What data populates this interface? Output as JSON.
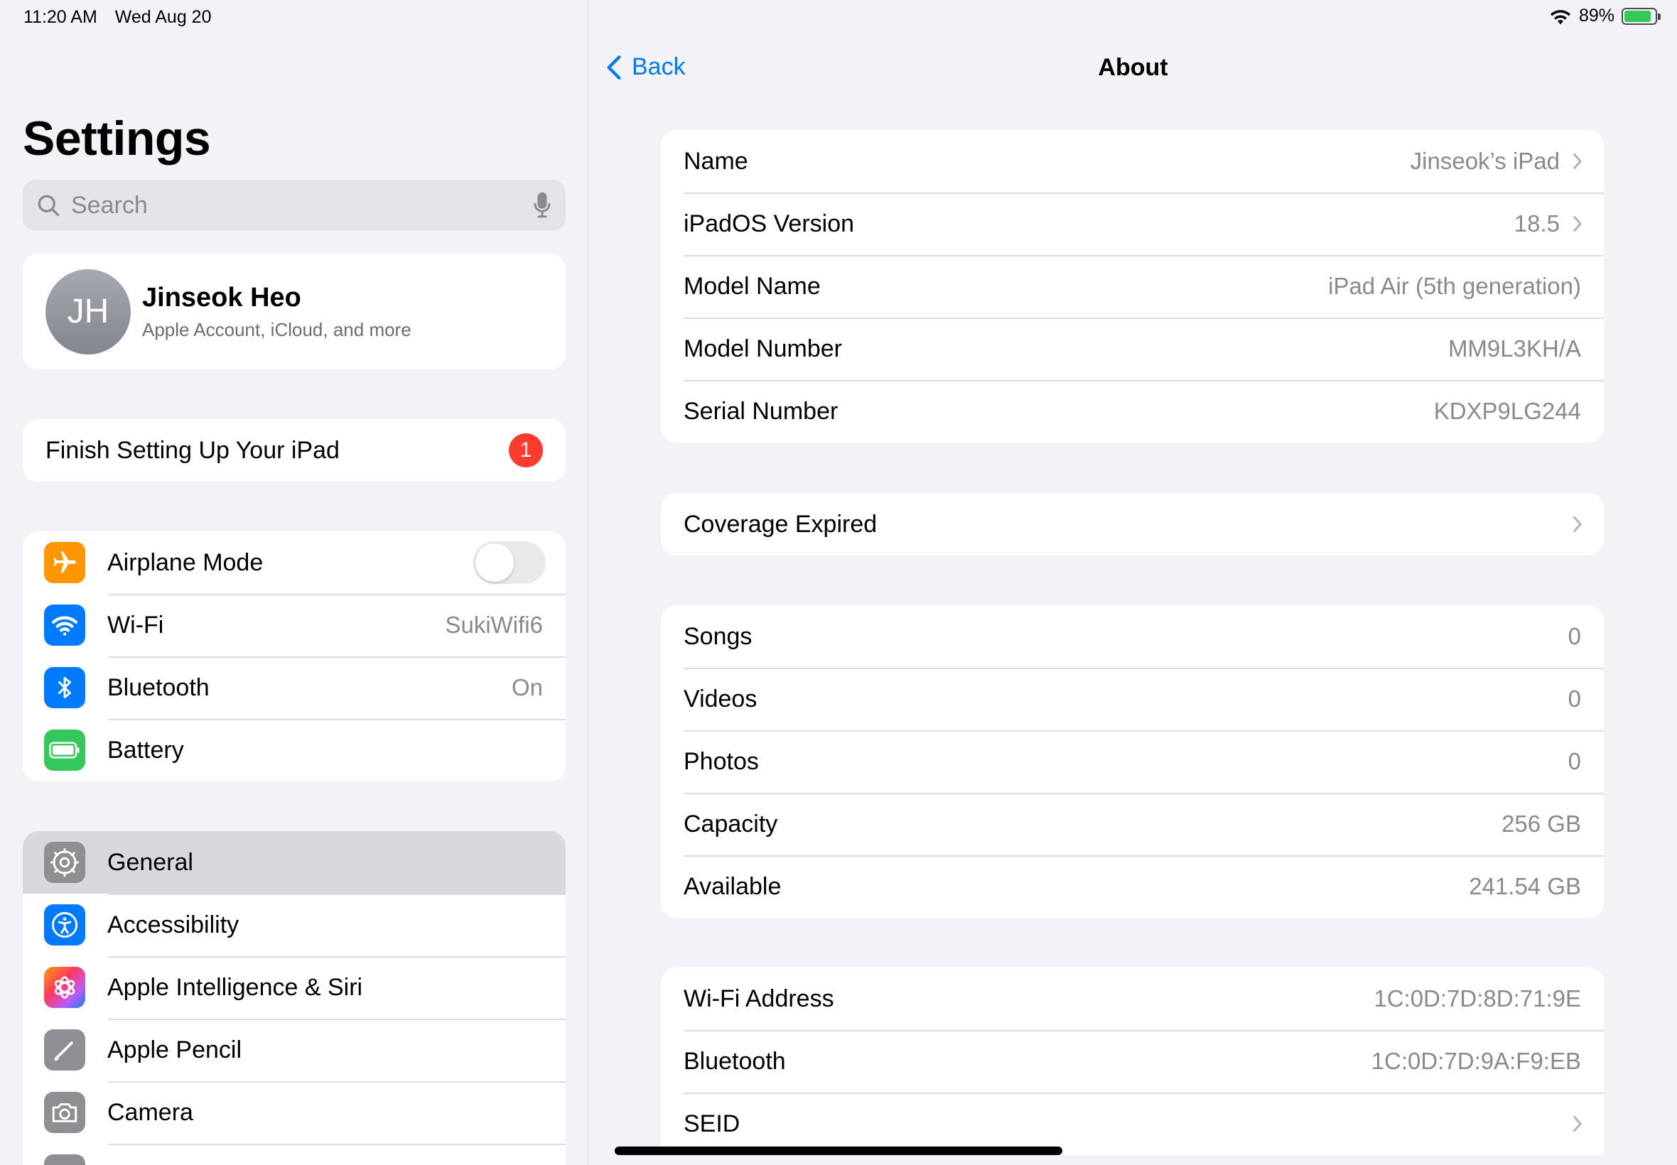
{
  "status": {
    "time": "11:20 AM",
    "date": "Wed Aug 20",
    "battery": "89%",
    "battery_level": 0.89
  },
  "sidebar": {
    "title": "Settings",
    "search_placeholder": "Search",
    "profile": {
      "initials": "JH",
      "name": "Jinseok Heo",
      "subtitle": "Apple Account, iCloud, and more"
    },
    "finish": {
      "label": "Finish Setting Up Your iPad",
      "badge": "1"
    },
    "group1": [
      {
        "label": "Airplane Mode",
        "icon": "airplane-icon",
        "color": "#ff9500",
        "toggle": false
      },
      {
        "label": "Wi-Fi",
        "icon": "wifi-icon",
        "color": "#007aff",
        "value": "SukiWifi6"
      },
      {
        "label": "Bluetooth",
        "icon": "bluetooth-icon",
        "color": "#007aff",
        "value": "On"
      },
      {
        "label": "Battery",
        "icon": "battery-icon",
        "color": "#34c759"
      }
    ],
    "group2": [
      {
        "label": "General",
        "icon": "gear-icon",
        "color": "#8e8e93",
        "selected": true
      },
      {
        "label": "Accessibility",
        "icon": "accessibility-icon",
        "color": "#007aff"
      },
      {
        "label": "Apple Intelligence & Siri",
        "icon": "apple-intelligence-icon",
        "color": "#ff6bb5"
      },
      {
        "label": "Apple Pencil",
        "icon": "pencil-icon",
        "color": "#8e8e93"
      },
      {
        "label": "Camera",
        "icon": "camera-icon",
        "color": "#8e8e93"
      }
    ]
  },
  "detail": {
    "back_label": "Back",
    "title": "About",
    "group1": [
      {
        "label": "Name",
        "value": "Jinseok’s iPad",
        "chevron": true
      },
      {
        "label": "iPadOS Version",
        "value": "18.5",
        "chevron": true
      },
      {
        "label": "Model Name",
        "value": "iPad Air (5th generation)"
      },
      {
        "label": "Model Number",
        "value": "MM9L3KH/A"
      },
      {
        "label": "Serial Number",
        "value": "KDXP9LG244"
      }
    ],
    "group2": [
      {
        "label": "Coverage Expired",
        "chevron": true
      }
    ],
    "group3": [
      {
        "label": "Songs",
        "value": "0"
      },
      {
        "label": "Videos",
        "value": "0"
      },
      {
        "label": "Photos",
        "value": "0"
      },
      {
        "label": "Capacity",
        "value": "256 GB"
      },
      {
        "label": "Available",
        "value": "241.54 GB"
      }
    ],
    "group4": [
      {
        "label": "Wi-Fi Address",
        "value": "1C:0D:7D:8D:71:9E"
      },
      {
        "label": "Bluetooth",
        "value": "1C:0D:7D:9A:F9:EB"
      },
      {
        "label": "SEID",
        "chevron": true
      }
    ]
  }
}
